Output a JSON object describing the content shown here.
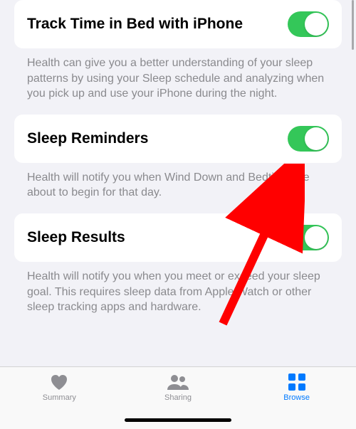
{
  "settings": [
    {
      "title": "Track Time in Bed with iPhone",
      "description": "Health can give you a better understanding of your sleep patterns by using your Sleep schedule and analyzing when you pick up and use your iPhone during the night.",
      "toggled": true
    },
    {
      "title": "Sleep Reminders",
      "description": "Health will notify you when Wind Down and Bedtime are about to begin for that day.",
      "toggled": true
    },
    {
      "title": "Sleep Results",
      "description": "Health will notify you when you meet or exceed your sleep goal. This requires sleep data from Apple Watch or other sleep tracking apps and hardware.",
      "toggled": true
    }
  ],
  "tabs": {
    "summary": "Summary",
    "sharing": "Sharing",
    "browse": "Browse",
    "active": "browse"
  },
  "colors": {
    "toggle_on": "#34c759",
    "accent": "#007aff",
    "inactive": "#8e8e93"
  },
  "annotation": {
    "arrow_points_to": "sleep-reminders-toggle"
  }
}
